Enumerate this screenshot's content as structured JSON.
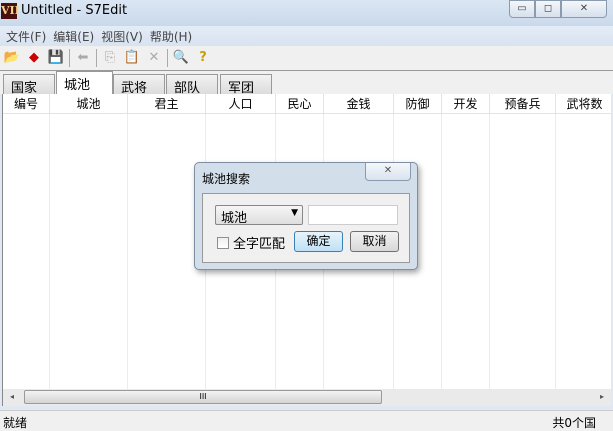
{
  "window": {
    "title": "Untitled - S7Edit",
    "icon_text": "VII",
    "min": "▭",
    "max": "◻",
    "close": "✕"
  },
  "menu": [
    "文件(F)",
    "编辑(E)",
    "视图(V)",
    "帮助(H)"
  ],
  "toolbar": {
    "open": "📂",
    "tag": "◆",
    "save": "💾",
    "back": "⬅",
    "copy": "⎘",
    "paste": "📋",
    "delete": "✕",
    "find": "🔍",
    "help": "?"
  },
  "tabs": [
    "国家",
    "城池",
    "武将",
    "部队",
    "军团"
  ],
  "active_tab": 1,
  "columns": [
    "编号",
    "城池",
    "君主",
    "人口",
    "民心",
    "金钱",
    "防御",
    "开发",
    "预备兵",
    "武将数"
  ],
  "scroll": {
    "left": "◂",
    "right": "▸",
    "grip": "III"
  },
  "status": {
    "left": "就绪",
    "right": "共0个国"
  },
  "dialog": {
    "title": "城池搜索",
    "close": "✕",
    "select_value": "城池",
    "dropdown": "▼",
    "input_value": "",
    "checkbox_label": "全字匹配",
    "checked": false,
    "ok": "确定",
    "cancel": "取消"
  }
}
